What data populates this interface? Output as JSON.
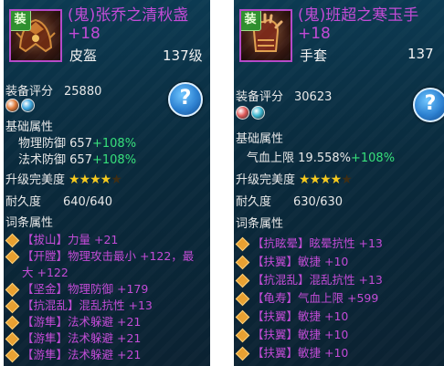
{
  "left": {
    "tag": "装",
    "name": "(鬼)张乔之清秋盏",
    "plus": "+18",
    "type": "皮盔",
    "level": "137级",
    "score_label": "装备评分",
    "score": "25880",
    "help": "?",
    "base_label": "基础属性",
    "base": [
      {
        "name": "物理防御",
        "value": "657",
        "bonus": "+108%"
      },
      {
        "name": "法术防御",
        "value": "657",
        "bonus": "+108%"
      }
    ],
    "perfect_label": "升级完美度",
    "stars_on": "★★★★",
    "stars_off": "★",
    "durability_label": "耐久度",
    "durability": "640/640",
    "affix_label": "词条属性",
    "affixes": [
      "【拔山】力量 +21",
      "【开膛】物理攻击最小 +122，最",
      "大 +122",
      "【坚金】物理防御 +179",
      "【抗混乱】混乱抗性 +13",
      "【游隼】法术躲避 +21",
      "【游隼】法术躲避 +21",
      "【游隼】法术躲避 +21"
    ],
    "gem_colors": [
      "#e07a3a",
      "#3aa6e0"
    ]
  },
  "right": {
    "tag": "装",
    "name": "(鬼)班超之寒玉手",
    "plus": "+18",
    "type": "手套",
    "level": "137",
    "score_label": "装备评分",
    "score": "30623",
    "help": "?",
    "base_label": "基础属性",
    "base": [
      {
        "name": "气血上限",
        "value": "19.558%",
        "bonus": "+108%"
      }
    ],
    "perfect_label": "升级完美度",
    "stars_on": "★★★★",
    "stars_off": "★",
    "durability_label": "耐久度",
    "durability": "630/630",
    "affix_label": "词条属性",
    "affixes": [
      "【抗眩晕】眩晕抗性 +13",
      "【扶翼】敏捷 +10",
      "【抗混乱】混乱抗性 +13",
      "【龟寿】气血上限 +599",
      "【扶翼】敏捷 +10",
      "【扶翼】敏捷 +10",
      "【扶翼】敏捷 +10"
    ],
    "gem_colors": [
      "#e05a5a",
      "#3ab6d0"
    ]
  }
}
